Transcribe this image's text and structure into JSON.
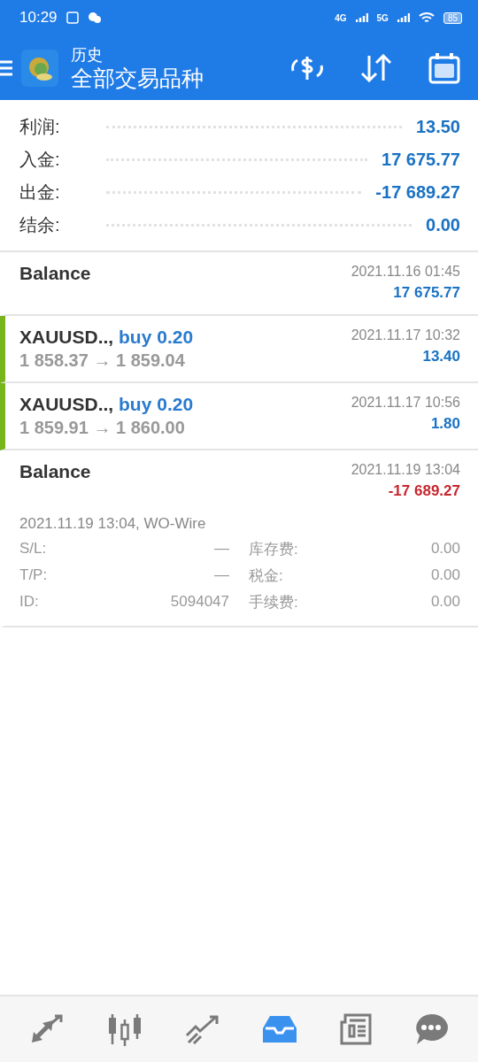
{
  "status_bar": {
    "time": "10:29",
    "network_1": "4G",
    "network_2": "5G",
    "battery": "85"
  },
  "toolbar": {
    "title": "历史",
    "subtitle": "全部交易品种"
  },
  "summary": [
    {
      "label": "利润:",
      "value": "13.50"
    },
    {
      "label": "入金:",
      "value": "17 675.77"
    },
    {
      "label": "出金:",
      "value": "-17 689.27"
    },
    {
      "label": "结余:",
      "value": "0.00"
    }
  ],
  "deals": [
    {
      "kind": "balance",
      "title": "Balance",
      "time": "2021.11.16 01:45",
      "amount": "17 675.77",
      "negative": false
    },
    {
      "kind": "trade",
      "symbol": "XAUUSD..,",
      "side": "buy 0.20",
      "prices": "1 858.37 → 1 859.04",
      "time": "2021.11.17 10:32",
      "amount": "13.40",
      "negative": false
    },
    {
      "kind": "trade",
      "symbol": "XAUUSD..,",
      "side": "buy 0.20",
      "prices": "1 859.91 → 1 860.00",
      "time": "2021.11.17 10:56",
      "amount": "1.80",
      "negative": false
    },
    {
      "kind": "balance",
      "title": "Balance",
      "time": "2021.11.19 13:04",
      "amount": "-17 689.27",
      "negative": true,
      "comment": "2021.11.19 13:04, WO-Wire",
      "details": [
        {
          "label": "S/L:",
          "value": "—",
          "label_2": "库存费:",
          "value_2": "0.00"
        },
        {
          "label": "T/P:",
          "value": "—",
          "label_2": "税金:",
          "value_2": "0.00"
        },
        {
          "label": "ID:",
          "value": "5094047",
          "label_2": "手续费:",
          "value_2": "0.00"
        }
      ]
    }
  ],
  "bottom_nav": [
    {
      "kind": "quotes",
      "selected": false
    },
    {
      "kind": "chart",
      "selected": false
    },
    {
      "kind": "trade",
      "selected": false
    },
    {
      "kind": "history",
      "selected": true
    },
    {
      "kind": "news",
      "selected": false
    },
    {
      "kind": "chat",
      "selected": false
    }
  ]
}
